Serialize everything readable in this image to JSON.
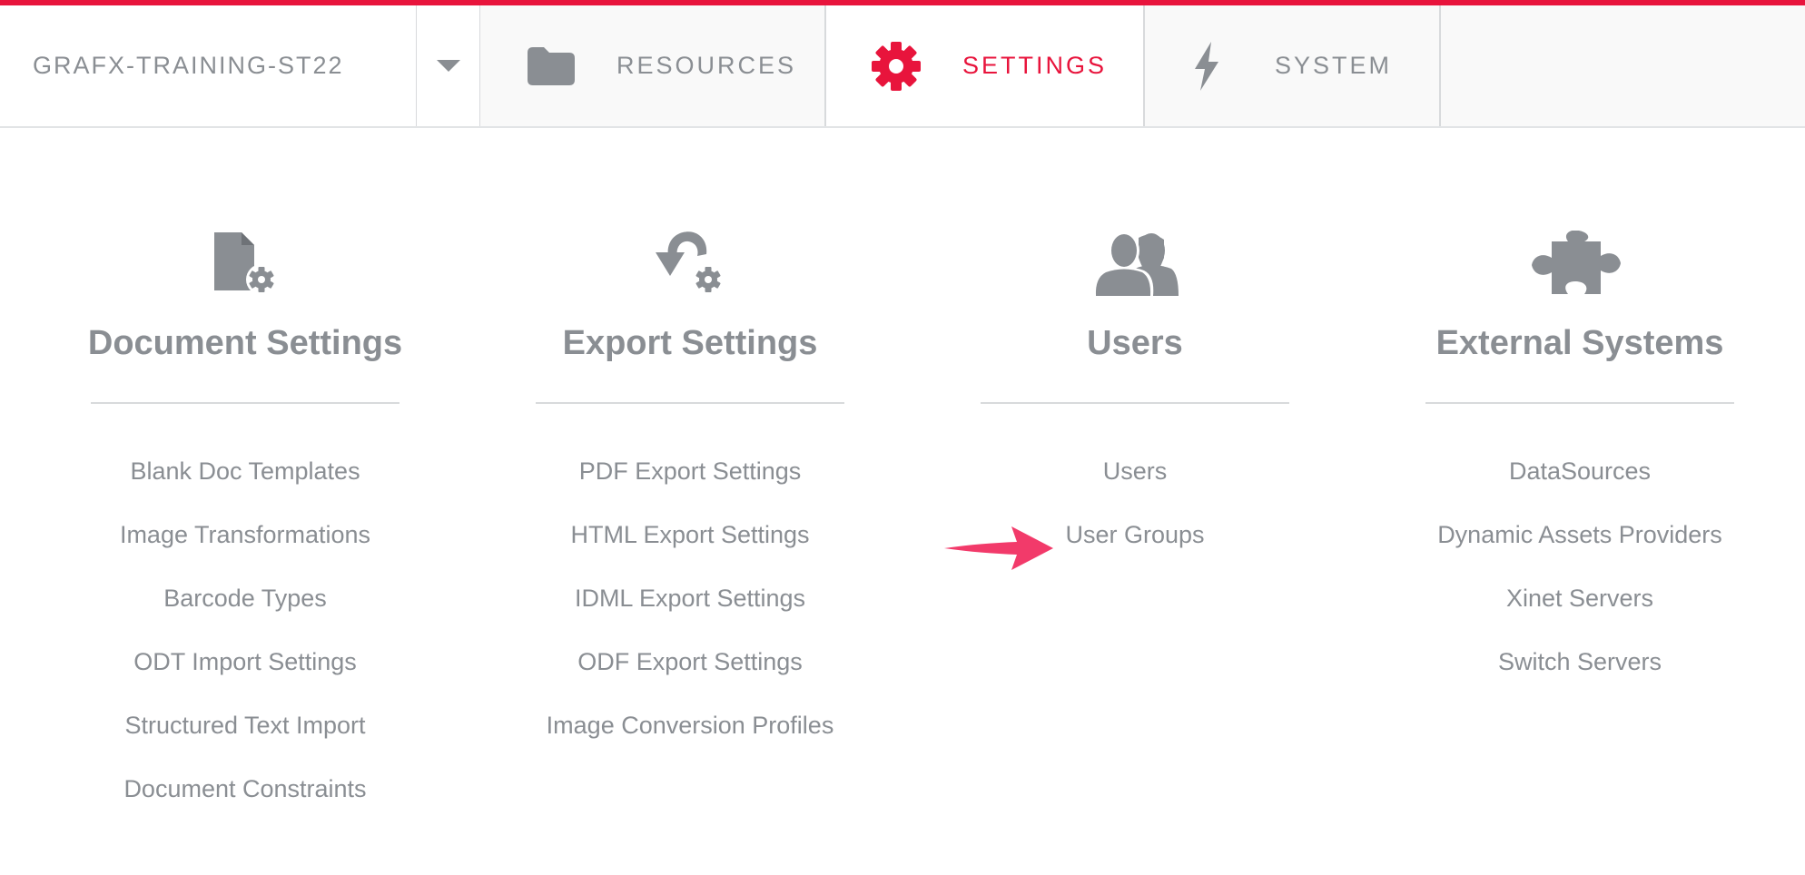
{
  "header": {
    "environment": "GRAFX-TRAINING-ST22",
    "tabs": [
      {
        "label": "RESOURCES",
        "icon": "folder-icon"
      },
      {
        "label": "SETTINGS",
        "icon": "gear-icon",
        "active": true
      },
      {
        "label": "SYSTEM",
        "icon": "lightning-icon"
      }
    ]
  },
  "colors": {
    "accent": "#e8143c",
    "text": "#8a8e93",
    "divider": "#d8dadc",
    "annotation_arrow": "#f23a6a"
  },
  "columns": [
    {
      "icon": "document-settings-icon",
      "title": "Document Settings",
      "links": [
        "Blank Doc Templates",
        "Image Transformations",
        "Barcode Types",
        "ODT Import Settings",
        "Structured Text Import",
        "Document Constraints"
      ]
    },
    {
      "icon": "export-settings-icon",
      "title": "Export Settings",
      "links": [
        "PDF Export Settings",
        "HTML Export Settings",
        "IDML Export Settings",
        "ODF Export Settings",
        "Image Conversion Profiles"
      ]
    },
    {
      "icon": "users-icon",
      "title": "Users",
      "links": [
        "Users",
        "User Groups"
      ]
    },
    {
      "icon": "puzzle-icon",
      "title": "External Systems",
      "links": [
        "DataSources",
        "Dynamic Assets Providers",
        "Xinet Servers",
        "Switch Servers"
      ]
    }
  ]
}
